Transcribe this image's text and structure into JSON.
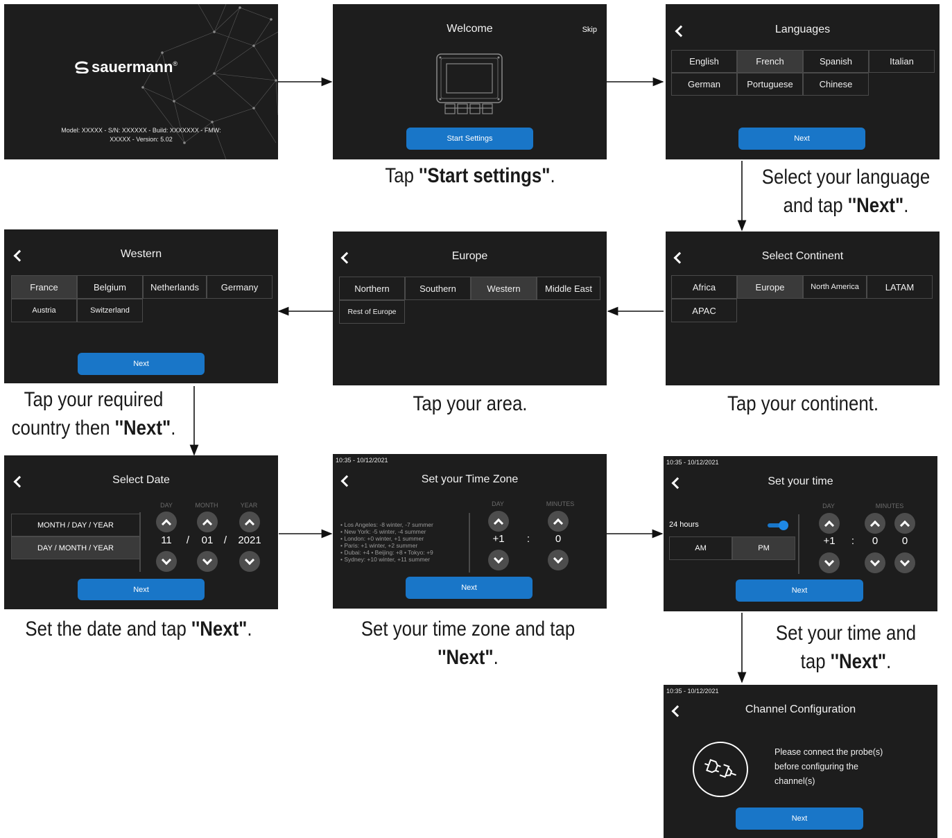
{
  "splash": {
    "brand": "sauermann",
    "registered": "®",
    "info_line1": "Model: XXXXX - S/N: XXXXXX - Build: XXXXXXX - FMW:",
    "info_line2": "XXXXX - Version: 5.02"
  },
  "welcome": {
    "title": "Welcome",
    "skip": "Skip",
    "button": "Start Settings",
    "caption_pre": "Tap ",
    "caption_bold": "''Start settings\"",
    "caption_post": "."
  },
  "languages": {
    "title": "Languages",
    "options": [
      "English",
      "French",
      "Spanish",
      "Italian",
      "German",
      "Portuguese",
      "Chinese"
    ],
    "selected": "French",
    "button": "Next",
    "caption_line1": "Select your language",
    "caption_pre": "and tap ",
    "caption_bold": "''Next\"",
    "caption_post": "."
  },
  "continent": {
    "title": "Select Continent",
    "options": [
      "Africa",
      "Europe",
      "North America",
      "LATAM",
      "APAC"
    ],
    "selected": "Europe",
    "caption": "Tap your continent."
  },
  "europe": {
    "title": "Europe",
    "options": [
      "Northern",
      "Southern",
      "Western",
      "Middle East",
      "Rest of Europe"
    ],
    "selected": "Western",
    "caption": "Tap your area."
  },
  "western": {
    "title": "Western",
    "options": [
      "France",
      "Belgium",
      "Netherlands",
      "Germany",
      "Austria",
      "Switzerland"
    ],
    "selected": "France",
    "button": "Next",
    "caption_line1": "Tap your required",
    "caption_pre": "country then ",
    "caption_bold": "''Next\"",
    "caption_post": "."
  },
  "date": {
    "title": "Select Date",
    "format1": "MONTH / DAY / YEAR",
    "format2": "DAY / MONTH / YEAR",
    "col_day": "DAY",
    "col_month": "MONTH",
    "col_year": "YEAR",
    "day": "11",
    "month": "01",
    "year": "2021",
    "sep": "/",
    "button": "Next",
    "caption_pre": "Set the date and tap ",
    "caption_bold": "''Next\"",
    "caption_post": "."
  },
  "timezone": {
    "status": "10:35 - 10/12/2021",
    "title": "Set your Time Zone",
    "zones": [
      "• Los Angeles: -8 winter, -7 summer",
      "• New York: -5 winter, -4 summer",
      "• London: +0 winter, +1 summer",
      "• Paris: +1 winter, +2 summer",
      "• Dubai: +4  • Beijing: +8  • Tokyo: +9",
      "• Sydney: +10 winter, +11 summer"
    ],
    "col_day": "DAY",
    "col_minutes": "MINUTES",
    "day": "+1",
    "colon": ":",
    "minutes": "0",
    "button": "Next",
    "caption_line1": "Set your time zone and tap",
    "caption_bold": "''Next\"",
    "caption_post": "."
  },
  "time": {
    "status": "10:35 - 10/12/2021",
    "title": "Set your time",
    "hours24": "24 hours",
    "am": "AM",
    "pm": "PM",
    "col_day": "DAY",
    "col_minutes": "MINUTES",
    "day": "+1",
    "colon": ":",
    "min1": "0",
    "min2": "0",
    "button": "Next",
    "caption_line1": "Set your time and",
    "caption_pre": "tap ",
    "caption_bold": "''Next\"",
    "caption_post": "."
  },
  "channel": {
    "status": "10:35 - 10/12/2021",
    "title": "Channel Configuration",
    "msg1": "Please connect the probe(s)",
    "msg2": "before configuring the",
    "msg3": "channel(s)",
    "button": "Next"
  },
  "colors": {
    "screen_bg": "#1d1d1d",
    "accent": "#1976c8",
    "selected_cell": "#3a3a3a"
  }
}
